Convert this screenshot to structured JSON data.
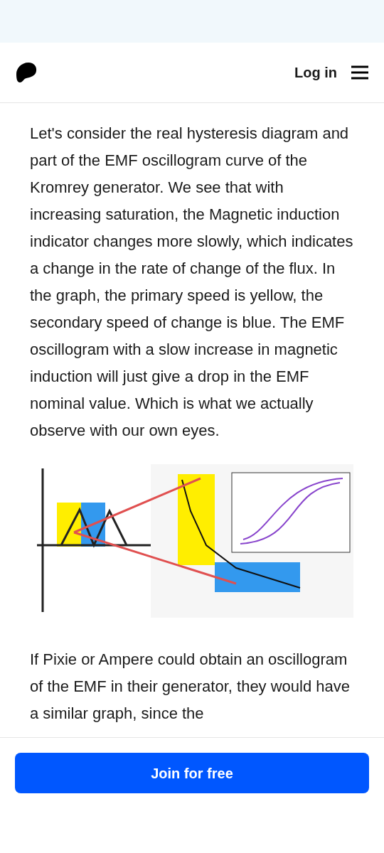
{
  "header": {
    "login": "Log in"
  },
  "article": {
    "paragraphs": [
      "Let's consider the real hysteresis diagram and part of the EMF oscillogram curve of the Kromrey generator. We see that with increasing saturation, the Magnetic induction indicator changes more slowly, which indicates a change in the rate of change of the flux. In the graph, the primary speed is yellow, the secondary speed of change is blue. The EMF oscillogram with a slow increase in magnetic induction will just give a drop in the EMF nominal value. Which is what we actually observe with our own eyes."
    ],
    "paragraphs_after": [
      "If Pixie or Ampere could obtain an oscillogram of the EMF in their generator, they would have a similar graph, since the"
    ]
  },
  "footer": {
    "button": "Join for free"
  }
}
